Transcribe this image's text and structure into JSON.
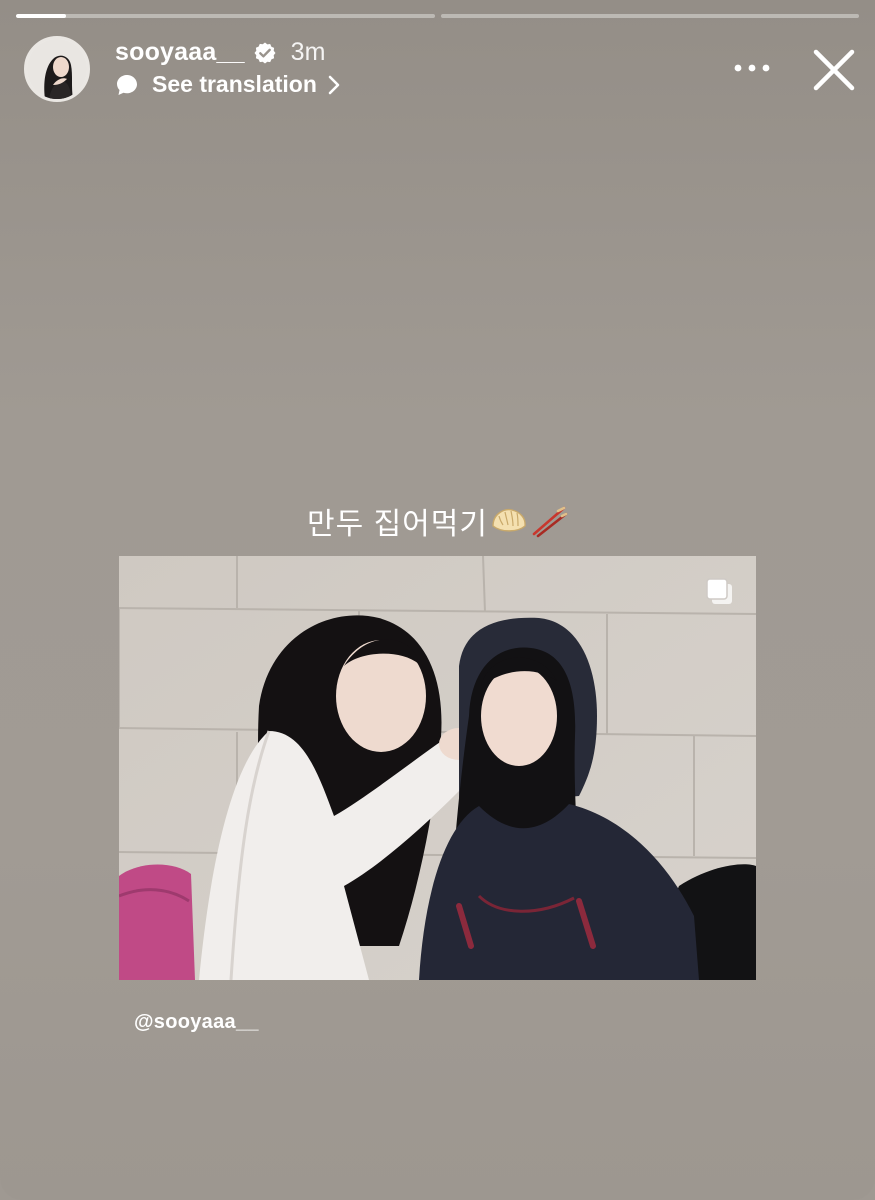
{
  "story": {
    "progress": [
      0.12,
      0
    ],
    "username": "sooyaaa__",
    "verified": true,
    "time_ago": "3m",
    "translate_label": "See translation",
    "icons": {
      "verified": "verified-badge-icon",
      "translate": "speech-bubble-icon",
      "chevron": "chevron-right-icon",
      "more": "more-horizontal-icon",
      "close": "close-icon",
      "multi": "multiple-images-icon"
    },
    "caption": "만두 집어먹기",
    "caption_emojis": [
      "dumpling-emoji",
      "chopsticks-emoji"
    ],
    "mention": "@sooyaaa__"
  },
  "colors": {
    "background": "#9f9992",
    "text": "#ffffff",
    "verified": "#ffffff"
  }
}
